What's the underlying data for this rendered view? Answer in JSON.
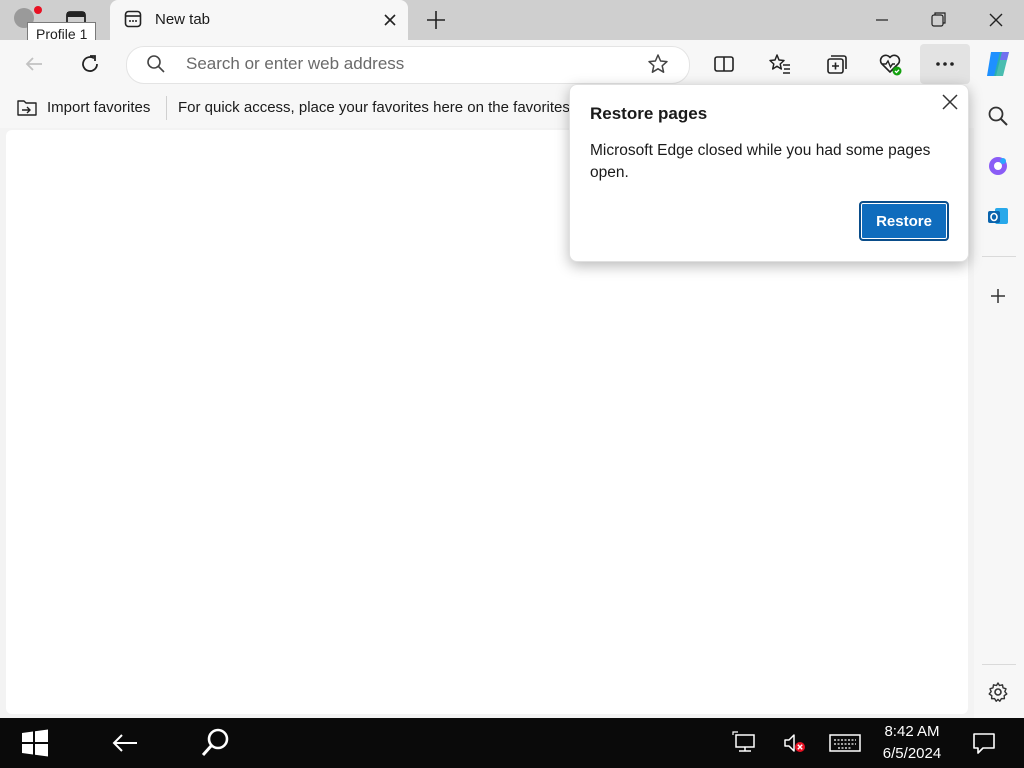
{
  "tab": {
    "title": "New tab"
  },
  "tooltip": {
    "text": "Profile 1"
  },
  "addressbar": {
    "placeholder": "Search or enter web address"
  },
  "favorites_bar": {
    "import_label": "Import favorites",
    "message": "For quick access, place your favorites here on the favorites bar."
  },
  "popup": {
    "title": "Restore pages",
    "message": "Microsoft Edge closed while you had some pages open.",
    "restore_label": "Restore"
  },
  "taskbar": {
    "time": "8:42 AM",
    "date": "6/5/2024"
  },
  "colors": {
    "accent": "#0f6cbd",
    "taskbar": "#0a0a0a",
    "profile_badge": "#e81123"
  }
}
